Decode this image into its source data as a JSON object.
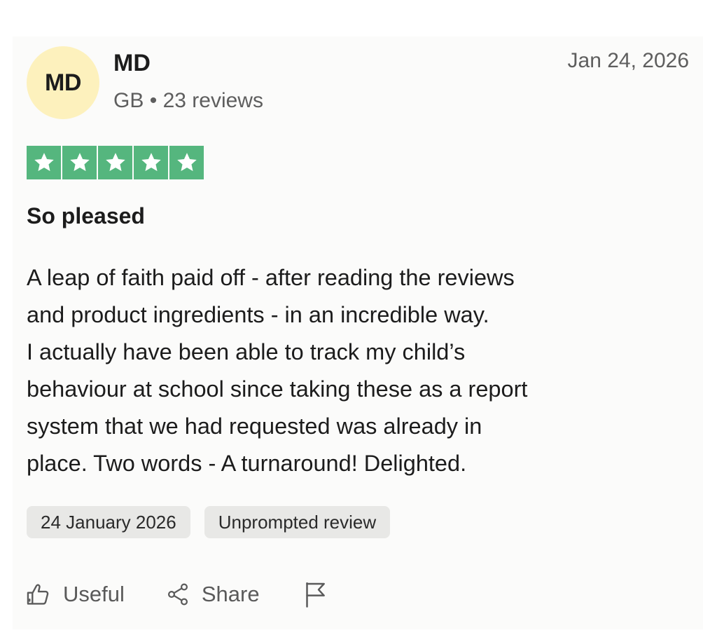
{
  "reviewer": {
    "initials": "MD",
    "name": "MD",
    "country": "GB",
    "separator": "•",
    "review_count": "23 reviews"
  },
  "review": {
    "date_short": "Jan 24, 2026",
    "rating": 5,
    "rating_max": 5,
    "title": "So pleased",
    "body_lines": [
      "A leap of faith paid off - after reading the reviews",
      "and product ingredients - in an incredible way.",
      "I actually have been able to track my child’s",
      "behaviour at school since taking these as a report",
      "system that we had requested was already in",
      "place. Two words - A turnaround! Delighted."
    ],
    "date_of_experience": "24 January 2026",
    "review_type": "Unprompted review"
  },
  "actions": {
    "useful_label": "Useful",
    "share_label": "Share"
  },
  "colors": {
    "star_green": "#55b67e",
    "avatar_bg": "#fdf1bd",
    "chip_bg": "#e8e8e6",
    "muted_text": "#5e5e5e"
  },
  "icons": {
    "useful": "thumbs-up-icon",
    "share": "share-icon",
    "report": "flag-icon",
    "star": "star-icon"
  }
}
